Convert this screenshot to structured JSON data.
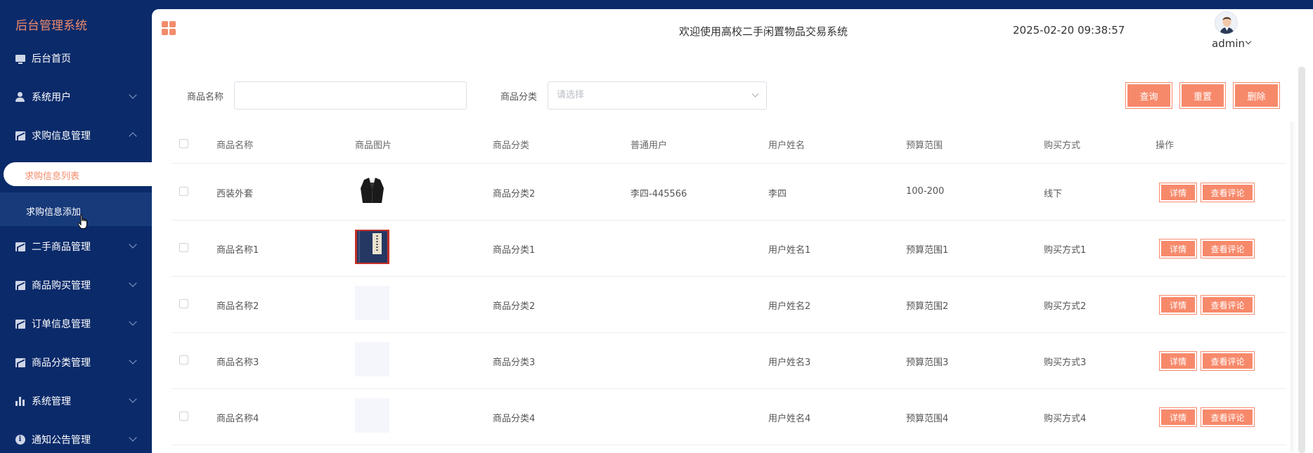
{
  "app": {
    "brand": "后台管理系统"
  },
  "sidebar": {
    "items": [
      {
        "label": "后台首页",
        "icon": "monitor-icon"
      },
      {
        "label": "系统用户",
        "icon": "user-icon"
      },
      {
        "label": "求购信息管理",
        "icon": "chart-box-icon"
      },
      {
        "label": "二手商品管理",
        "icon": "chart-box-icon"
      },
      {
        "label": "商品购买管理",
        "icon": "chart-box-icon"
      },
      {
        "label": "订单信息管理",
        "icon": "chart-box-icon"
      },
      {
        "label": "商品分类管理",
        "icon": "chart-box-icon"
      },
      {
        "label": "系统管理",
        "icon": "bar-chart-icon"
      },
      {
        "label": "通知公告管理",
        "icon": "info-icon"
      }
    ],
    "sub_items": [
      {
        "label": "求购信息列表",
        "active": true
      },
      {
        "label": "求购信息添加",
        "hover": true
      }
    ]
  },
  "header": {
    "title": "欢迎使用高校二手闲置物品交易系统",
    "datetime": "2025-02-20 09:38:57",
    "username": "admin"
  },
  "search": {
    "name_label": "商品名称",
    "name_value": "",
    "category_label": "商品分类",
    "category_placeholder": "请选择",
    "query_button": "查询",
    "reset_button": "重置",
    "delete_button": "删除"
  },
  "table": {
    "headers": [
      "商品名称",
      "商品图片",
      "商品分类",
      "普通用户",
      "用户姓名",
      "预算范围",
      "购买方式",
      "操作"
    ],
    "rows": [
      {
        "name": "西装外套",
        "image": "suit-jacket",
        "category": "商品分类2",
        "user": "李四-445566",
        "real_name": "李四",
        "budget": "100-200",
        "method": "线下"
      },
      {
        "name": "商品名称1",
        "image": "book-cover",
        "category": "商品分类1",
        "user": "",
        "real_name": "用户姓名1",
        "budget": "预算范围1",
        "method": "购买方式1"
      },
      {
        "name": "商品名称2",
        "image": "",
        "category": "商品分类2",
        "user": "",
        "real_name": "用户姓名2",
        "budget": "预算范围2",
        "method": "购买方式2"
      },
      {
        "name": "商品名称3",
        "image": "",
        "category": "商品分类3",
        "user": "",
        "real_name": "用户姓名3",
        "budget": "预算范围3",
        "method": "购买方式3"
      },
      {
        "name": "商品名称4",
        "image": "",
        "category": "商品分类4",
        "user": "",
        "real_name": "用户姓名4",
        "budget": "预算范围4",
        "method": "购买方式4"
      }
    ],
    "detail_button": "详情",
    "comments_button": "查看评论"
  },
  "colors": {
    "sidebar_bg": "#0a2a6a",
    "accent": "#f7896b",
    "brand": "#f28c6b"
  }
}
